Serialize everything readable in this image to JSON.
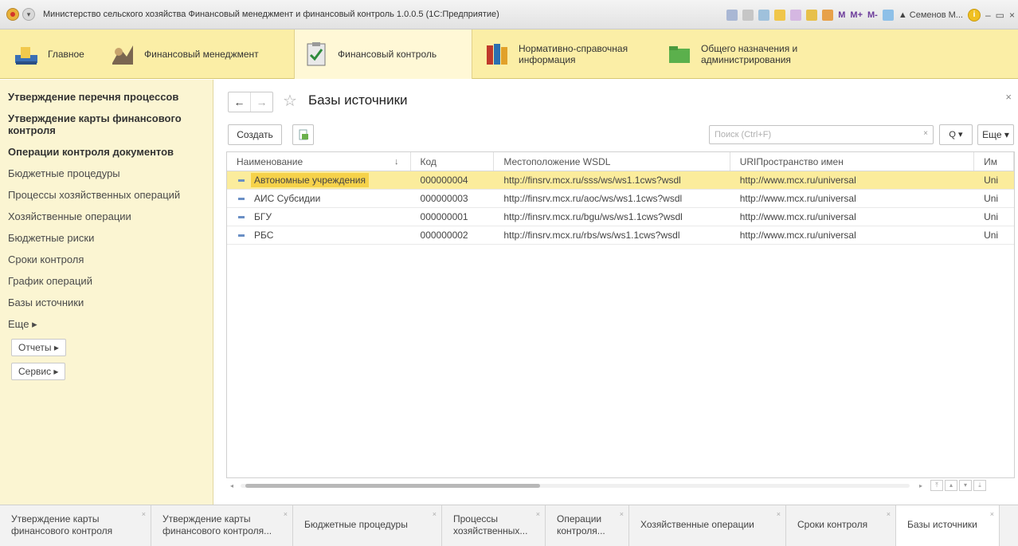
{
  "window": {
    "title": "Министерство сельского хозяйства Финансовый менеджмент и финансовый контроль 1.0.0.5 (1С:Предприятие)",
    "user": "Семенов М...",
    "m_buttons": [
      "M",
      "M+",
      "M-"
    ],
    "info_label": "i",
    "window_controls": [
      "–",
      "▭",
      "×"
    ]
  },
  "sections": [
    {
      "label": "Главное",
      "icon": "home-icon"
    },
    {
      "label": "Финансовый менеджмент",
      "icon": "finance-icon"
    },
    {
      "label": "Финансовый контроль",
      "icon": "checklist-icon"
    },
    {
      "label": "Нормативно-справочная информация",
      "icon": "books-icon"
    },
    {
      "label": "Общего назначения и администрирования",
      "icon": "folder-icon"
    }
  ],
  "leftnav": {
    "items": [
      "Утверждение перечня процессов",
      "Утверждение карты финансового контроля",
      "Операции контроля документов",
      "Бюджетные процедуры",
      "Процессы хозяйственных операций",
      "Хозяйственные операции",
      "Бюджетные риски",
      "Сроки контроля",
      "График операций",
      "Базы источники"
    ],
    "more_label": "Еще ▸",
    "reports_label": "Отчеты ▸",
    "service_label": "Сервис ▸"
  },
  "form": {
    "title": "Базы источники",
    "back": "←",
    "forward": "→",
    "star": "☆",
    "close": "×"
  },
  "toolbar": {
    "create_label": "Создать",
    "search_placeholder": "Поиск (Ctrl+F)",
    "search_clear": "×",
    "search_icon": "Q ▾",
    "more_label": "Еще ▾"
  },
  "table": {
    "columns": [
      "Наименование",
      "Код",
      "Местоположение WSDL",
      "URIПространство имен",
      "Им"
    ],
    "sort_icon": "↓",
    "rows": [
      {
        "name": "Автономные учреждения",
        "code": "000000004",
        "wsdl": "http://finsrv.mcx.ru/sss/ws/ws1.1cws?wsdl",
        "uri": "http://www.mcx.ru/universal",
        "extra": "Uni",
        "selected": true
      },
      {
        "name": "АИС Субсидии",
        "code": "000000003",
        "wsdl": "http://finsrv.mcx.ru/aoc/ws/ws1.1cws?wsdl",
        "uri": "http://www.mcx.ru/universal",
        "extra": "Uni",
        "selected": false
      },
      {
        "name": "БГУ",
        "code": "000000001",
        "wsdl": "http://finsrv.mcx.ru/bgu/ws/ws1.1cws?wsdl",
        "uri": "http://www.mcx.ru/universal",
        "extra": "Uni",
        "selected": false
      },
      {
        "name": "РБС",
        "code": "000000002",
        "wsdl": "http://finsrv.mcx.ru/rbs/ws/ws1.1cws?wsdl",
        "uri": "http://www.mcx.ru/universal",
        "extra": "Uni",
        "selected": false
      }
    ]
  },
  "tabs": [
    {
      "label": "Утверждение карты финансового контроля",
      "active": false
    },
    {
      "label": "Утверждение карты финансового контроля...",
      "active": false
    },
    {
      "label": "Бюджетные процедуры",
      "active": false
    },
    {
      "label": "Процессы хозяйственных...",
      "active": false
    },
    {
      "label": "Операции контроля...",
      "active": false
    },
    {
      "label": "Хозяйственные операции",
      "active": false
    },
    {
      "label": "Сроки контроля",
      "active": false
    },
    {
      "label": "Базы источники",
      "active": true
    }
  ],
  "colors": {
    "section_bg": "#fbeea6",
    "nav_bg": "#fbf5d2",
    "selected_row": "#fbec9c",
    "selected_cell": "#f6d24a"
  }
}
